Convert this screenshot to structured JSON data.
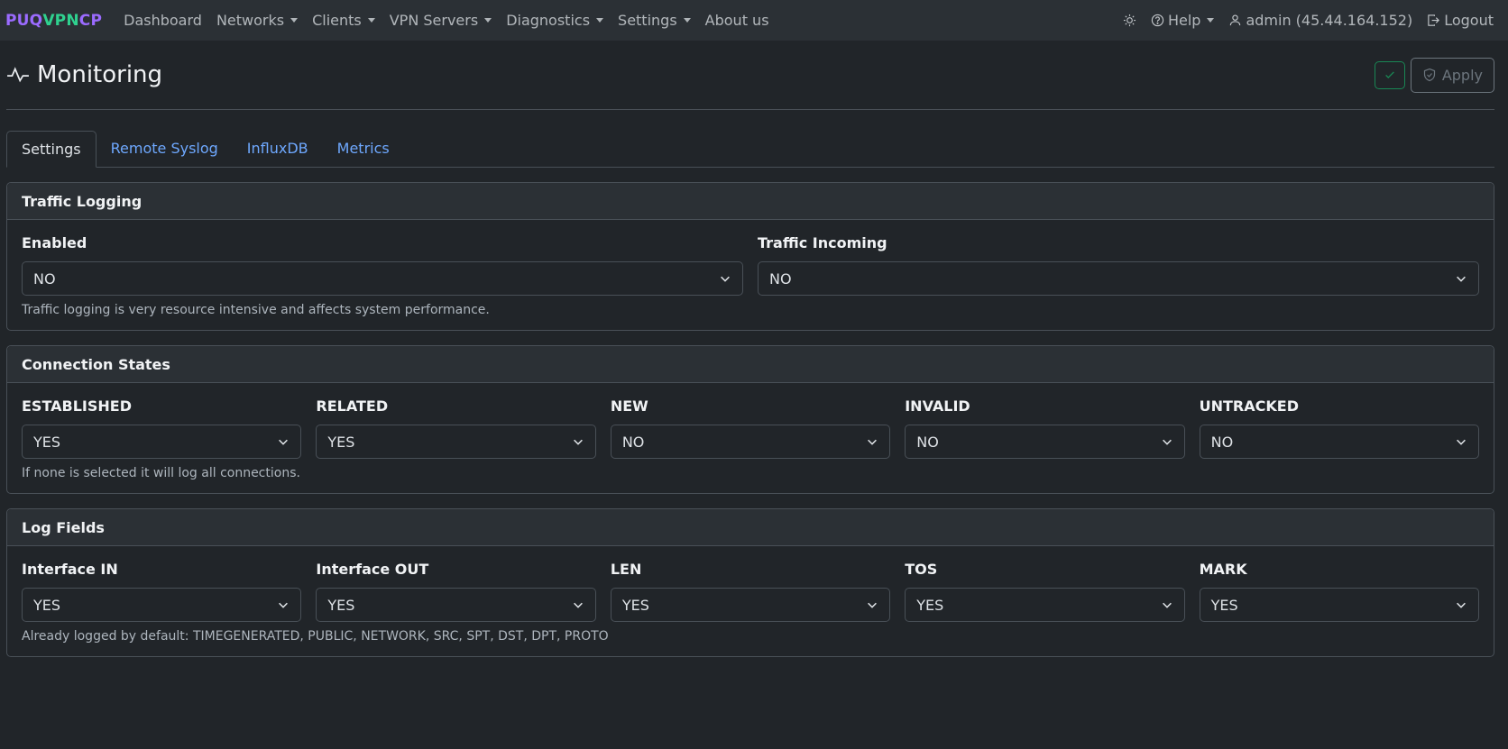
{
  "brand": {
    "part1": "PUQ",
    "part2": "VPN",
    "part3": "CP"
  },
  "nav": {
    "items": [
      {
        "label": "Dashboard",
        "dropdown": false
      },
      {
        "label": "Networks",
        "dropdown": true
      },
      {
        "label": "Clients",
        "dropdown": true
      },
      {
        "label": "VPN Servers",
        "dropdown": true
      },
      {
        "label": "Diagnostics",
        "dropdown": true
      },
      {
        "label": "Settings",
        "dropdown": true
      },
      {
        "label": "About us",
        "dropdown": false
      }
    ],
    "help": "Help",
    "user": "admin (45.44.164.152)",
    "logout": "Logout"
  },
  "page": {
    "title": "Monitoring",
    "apply_label": "Apply"
  },
  "tabs": [
    "Settings",
    "Remote Syslog",
    "InfluxDB",
    "Metrics"
  ],
  "traffic_logging": {
    "title": "Traffic Logging",
    "enabled_label": "Enabled",
    "enabled_value": "NO",
    "incoming_label": "Traffic Incoming",
    "incoming_value": "NO",
    "help": "Traffic logging is very resource intensive and affects system performance."
  },
  "connection_states": {
    "title": "Connection States",
    "fields": [
      {
        "label": "ESTABLISHED",
        "value": "YES"
      },
      {
        "label": "RELATED",
        "value": "YES"
      },
      {
        "label": "NEW",
        "value": "NO"
      },
      {
        "label": "INVALID",
        "value": "NO"
      },
      {
        "label": "UNTRACKED",
        "value": "NO"
      }
    ],
    "help": "If none is selected it will log all connections."
  },
  "log_fields": {
    "title": "Log Fields",
    "fields": [
      {
        "label": "Interface IN",
        "value": "YES"
      },
      {
        "label": "Interface OUT",
        "value": "YES"
      },
      {
        "label": "LEN",
        "value": "YES"
      },
      {
        "label": "TOS",
        "value": "YES"
      },
      {
        "label": "MARK",
        "value": "YES"
      }
    ],
    "help": "Already logged by default: TIMEGENERATED, PUBLIC, NETWORK, SRC, SPT, DST, DPT, PROTO"
  },
  "colors": {
    "accent_purple": "#9b6bff",
    "accent_green": "#2fd18f",
    "link_blue": "#6ea8fe",
    "success": "#198754"
  }
}
